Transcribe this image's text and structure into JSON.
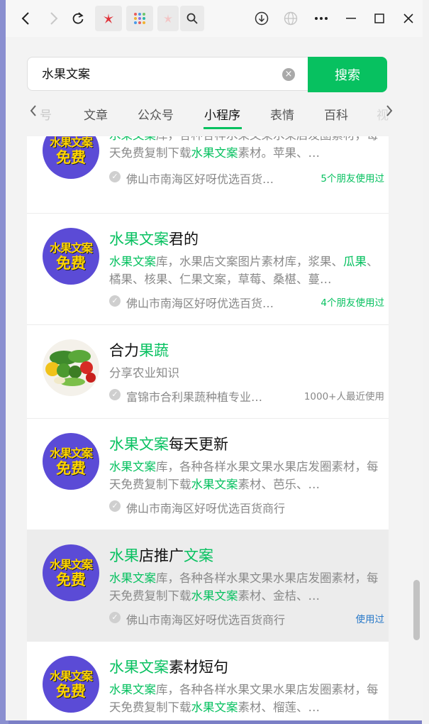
{
  "search": {
    "value": "水果文案",
    "clear_icon": "×",
    "button": "搜索"
  },
  "tabs": [
    "号",
    "文章",
    "公众号",
    "小程序",
    "表情",
    "百科",
    "视"
  ],
  "active_tab_index": 3,
  "results": [
    {
      "title_parts": [],
      "avatar_text": [
        "水果文案",
        "免费"
      ],
      "desc_parts": [
        {
          "t": "水果文案",
          "hl": true
        },
        {
          "t": "库，各种各样水果文果水果店发圈素材，每天免费复制下载",
          "hl": false
        },
        {
          "t": "水果文案",
          "hl": true
        },
        {
          "t": "素材。苹果、…",
          "hl": false
        }
      ],
      "org": "佛山市南海区好呀优选百货…",
      "right": "5个朋友使用过",
      "right_style": "green"
    },
    {
      "title_parts": [
        {
          "t": "水果文案",
          "hl": true
        },
        {
          "t": "君的",
          "hl": false
        }
      ],
      "avatar_text": [
        "水果文案",
        "免费"
      ],
      "desc_parts": [
        {
          "t": "水果文案",
          "hl": true
        },
        {
          "t": "库，水果店文案图片素材库，浆果、",
          "hl": false
        },
        {
          "t": "瓜果",
          "hl": true
        },
        {
          "t": "、橘果、核果、仁果文案，草莓、桑椹、蔓…",
          "hl": false
        }
      ],
      "org": "佛山市南海区好呀优选百货…",
      "right": "4个朋友使用过",
      "right_style": "green"
    },
    {
      "title_parts": [
        {
          "t": "合力",
          "hl": false
        },
        {
          "t": "果蔬",
          "hl": true
        }
      ],
      "avatar_text": [],
      "desc_parts": [
        {
          "t": "分享农业知识",
          "hl": false
        }
      ],
      "org": "富锦市合利果蔬种植专业…",
      "right": "1000+人最近使用",
      "right_style": "gray"
    },
    {
      "title_parts": [
        {
          "t": "水果文案",
          "hl": true
        },
        {
          "t": "每天更新",
          "hl": false
        }
      ],
      "avatar_text": [
        "水果文案",
        "免费"
      ],
      "desc_parts": [
        {
          "t": "水果文案",
          "hl": true
        },
        {
          "t": "库，各种各样水果文果水果店发圈素材，每天免费复制下载",
          "hl": false
        },
        {
          "t": "水果文案",
          "hl": true
        },
        {
          "t": "素材、芭乐、…",
          "hl": false
        }
      ],
      "org": "佛山市南海区好呀优选百货商行",
      "right": "",
      "right_style": "green"
    },
    {
      "title_parts": [
        {
          "t": "水果",
          "hl": true
        },
        {
          "t": "店推广",
          "hl": false
        },
        {
          "t": "文案",
          "hl": true
        }
      ],
      "avatar_text": [
        "水果文案",
        "免费"
      ],
      "desc_parts": [
        {
          "t": "水果文案",
          "hl": true
        },
        {
          "t": "库，各种各样水果文果水果店发圈素材，每天免费复制下载",
          "hl": false
        },
        {
          "t": "水果文案",
          "hl": true
        },
        {
          "t": "素材、金桔、…",
          "hl": false
        }
      ],
      "org": "佛山市南海区好呀优选百货商行",
      "right": "使用过",
      "right_style": "blue"
    },
    {
      "title_parts": [
        {
          "t": "水果文案",
          "hl": true
        },
        {
          "t": "素材短句",
          "hl": false
        }
      ],
      "avatar_text": [
        "水果文案",
        "免费"
      ],
      "desc_parts": [
        {
          "t": "水果文案",
          "hl": true
        },
        {
          "t": "库，各种各样水果文果水果店发圈素材，每天免费复制下载",
          "hl": false
        },
        {
          "t": "水果文案",
          "hl": true
        },
        {
          "t": "素材、榴莲、…",
          "hl": false
        }
      ],
      "org": "",
      "right": "",
      "right_style": "green"
    }
  ],
  "colors": {
    "accent": "#07c160",
    "avatar_bg": "#5b4bd6",
    "avatar_text": "#ffd400"
  }
}
